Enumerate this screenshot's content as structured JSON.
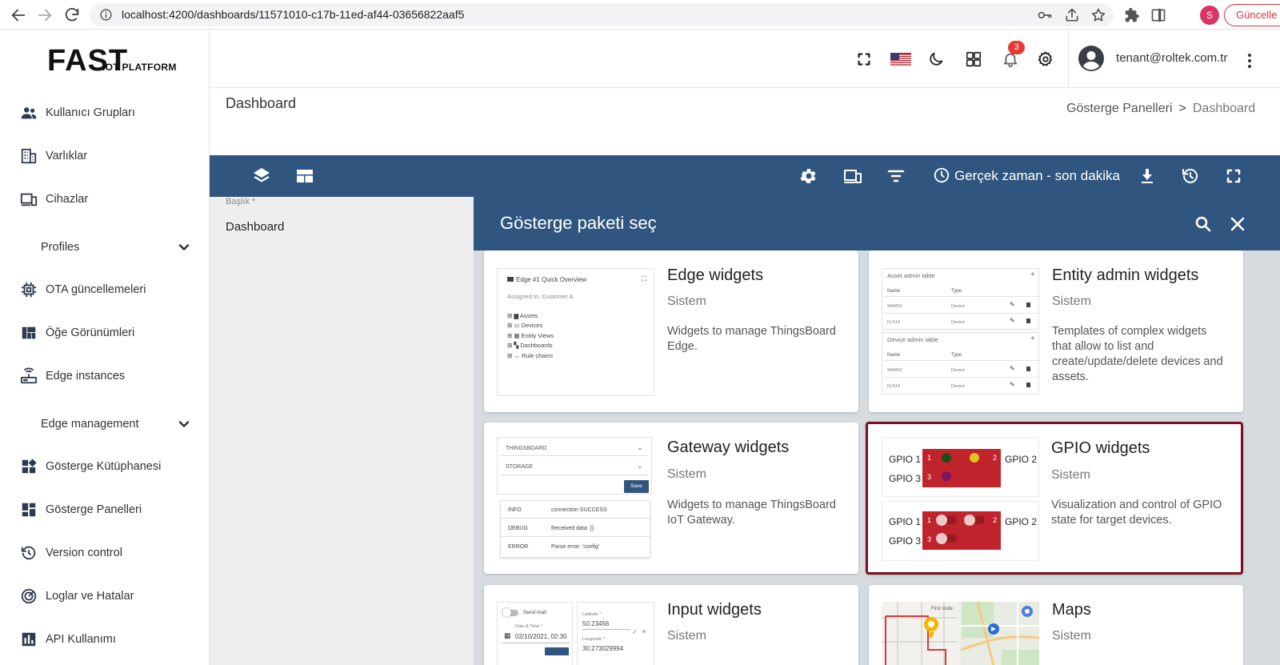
{
  "browser": {
    "url": "localhost:4200/dashboards/11571010-c17b-11ed-af44-03656822aaf5",
    "profile_initial": "S",
    "update_label": "Güncelle"
  },
  "sidebar": {
    "logo_main": "FAST",
    "logo_sub": "IOT PLATFORM",
    "items": [
      {
        "label": "Kullanıcı Grupları",
        "icon": "user-group-icon"
      },
      {
        "label": "Varlıklar",
        "icon": "building-icon"
      },
      {
        "label": "Cihazlar",
        "icon": "devices-icon"
      },
      {
        "label": "Profiles",
        "icon": "chevron-down-icon"
      },
      {
        "label": "OTA güncellemeleri",
        "icon": "chip-icon"
      },
      {
        "label": "Öğe Görünümleri",
        "icon": "view-quilt-icon"
      },
      {
        "label": "Edge instances",
        "icon": "router-icon"
      },
      {
        "label": "Edge management",
        "icon": "chevron-down-icon"
      },
      {
        "label": "Gösterge Kütüphanesi",
        "icon": "widgets-icon"
      },
      {
        "label": "Gösterge Panelleri",
        "icon": "dashboard-icon"
      },
      {
        "label": "Version control",
        "icon": "history-icon"
      },
      {
        "label": "Loglar ve Hatalar",
        "icon": "track-changes-icon"
      },
      {
        "label": "API Kullanımı",
        "icon": "bar-chart-icon"
      }
    ]
  },
  "header": {
    "notification_count": "3",
    "user_email": "tenant@roltek.com.tr"
  },
  "page": {
    "title": "Dashboard",
    "breadcrumb_parent": "Gösterge Panelleri",
    "breadcrumb_separator": ">",
    "breadcrumb_current": "Dashboard"
  },
  "toolbar": {
    "timewindow_label": "Gerçek zaman - son dakika"
  },
  "dashboard_form": {
    "title_label": "Başlık *",
    "title_value": "Dashboard"
  },
  "panel": {
    "title": "Gösterge paketi seç",
    "cards": [
      {
        "title": "Edge widgets",
        "subtitle": "Sistem",
        "description": "Widgets to manage ThingsBoard Edge."
      },
      {
        "title": "Entity admin widgets",
        "subtitle": "Sistem",
        "description": "Templates of complex widgets that allow to list and create/update/delete devices and assets."
      },
      {
        "title": "Gateway widgets",
        "subtitle": "Sistem",
        "description": "Widgets to manage ThingsBoard IoT Gateway."
      },
      {
        "title": "GPIO widgets",
        "subtitle": "Sistem",
        "description": "Visualization and control of GPIO state for target devices."
      },
      {
        "title": "Input widgets",
        "subtitle": "Sistem",
        "description": ""
      },
      {
        "title": "Maps",
        "subtitle": "Sistem",
        "description": ""
      }
    ],
    "thumbs": {
      "edge": {
        "title": "Edge #1 Quick Overview",
        "assigned": "Assigned to: Customer A",
        "tree": [
          "Assets",
          "Devices",
          "Entity Views",
          "Dashboards",
          "Rule chains"
        ]
      },
      "entity_admin": {
        "table1": "Asset admin table",
        "table2": "Device admin table",
        "col_name": "Name",
        "col_type": "Type",
        "rows": [
          [
            "WM452",
            "Device"
          ],
          [
            "KL514",
            "Device"
          ]
        ]
      },
      "gateway": {
        "select1": "THINGSBOARD",
        "select2": "STORAGE",
        "save": "Save",
        "logs": [
          [
            "INFO",
            "connection SUCCESS"
          ],
          [
            "DEBUG",
            "Received data: {}"
          ],
          [
            "ERROR",
            "Parse error: 'config'"
          ]
        ]
      },
      "gpio": {
        "g1": "GPIO 1",
        "g2": "GPIO 2",
        "g3": "GPIO 3",
        "n1": "1",
        "n2": "2",
        "n3": "3"
      },
      "input": {
        "send_mail": "Send mail",
        "date_label": "Date & Time *",
        "date_value": "02/10/2021, 02:30",
        "lat_label": "Latitude *",
        "lat_value": "50.23456",
        "lon_label": "Longitude *",
        "lon_value": "30.273029994"
      },
      "maps": {
        "route_label": "First route"
      }
    }
  },
  "colors": {
    "primary": "#305680",
    "selected_border": "#7d1020",
    "gpio_red": "#c1232c",
    "badge_red": "#e53935"
  }
}
